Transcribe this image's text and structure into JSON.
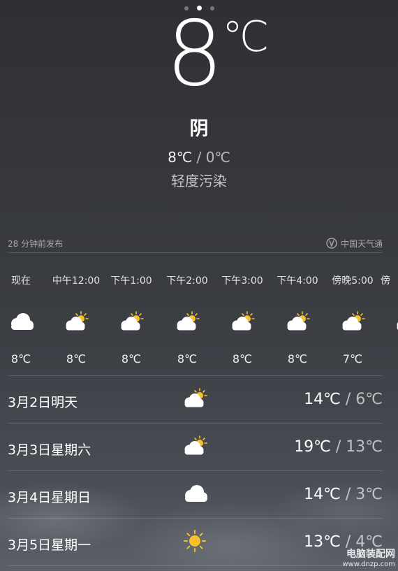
{
  "page_indicator": {
    "count": 3,
    "active": 2
  },
  "current": {
    "temperature": "8",
    "unit": "℃",
    "condition": "阴",
    "high": "8℃",
    "low": "0℃",
    "range_sep": " / ",
    "air_quality": "轻度污染"
  },
  "meta": {
    "published": "28 分钟前发布",
    "source": "中国天气通"
  },
  "hourly": [
    {
      "time": "现在",
      "icon": "cloud-icon",
      "temp": "8℃"
    },
    {
      "time": "中午12:00",
      "icon": "partly-cloudy-icon",
      "temp": "8℃"
    },
    {
      "time": "下午1:00",
      "icon": "partly-cloudy-icon",
      "temp": "8℃"
    },
    {
      "time": "下午2:00",
      "icon": "partly-cloudy-icon",
      "temp": "8℃"
    },
    {
      "time": "下午3:00",
      "icon": "partly-cloudy-icon",
      "temp": "8℃"
    },
    {
      "time": "下午4:00",
      "icon": "partly-cloudy-icon",
      "temp": "8℃"
    },
    {
      "time": "傍晚5:00",
      "icon": "partly-cloudy-icon",
      "temp": "7℃"
    },
    {
      "time": "傍",
      "icon": "partly-cloudy-icon",
      "temp": ""
    }
  ],
  "daily": [
    {
      "date": "3月2日明天",
      "icon": "partly-cloudy-icon",
      "high": "14℃",
      "low": "6℃"
    },
    {
      "date": "3月3日星期六",
      "icon": "partly-cloudy-icon",
      "high": "19℃",
      "low": "13℃"
    },
    {
      "date": "3月4日星期日",
      "icon": "cloud-icon",
      "high": "14℃",
      "low": "3℃"
    },
    {
      "date": "3月5日星期一",
      "icon": "sun-icon",
      "high": "13℃",
      "low": "4℃"
    }
  ],
  "watermark": {
    "name": "电脑装配网",
    "url": "www.dnzp.com"
  },
  "colors": {
    "sun": "#f6c12a",
    "cloud": "#ffffff"
  }
}
